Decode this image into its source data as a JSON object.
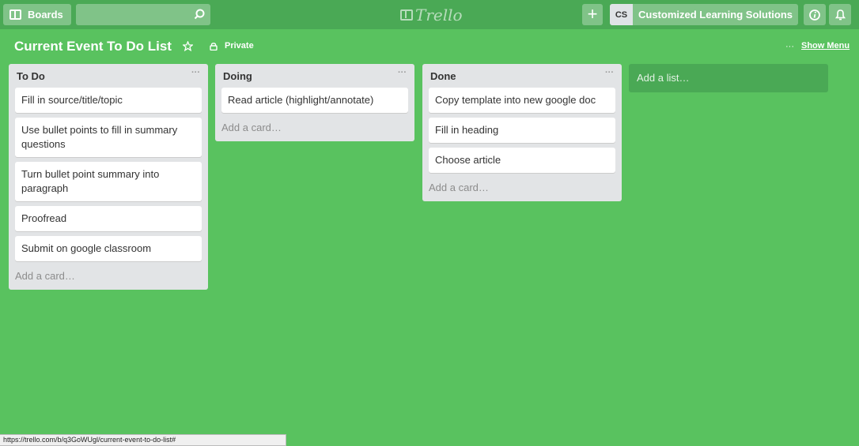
{
  "header": {
    "boards_label": "Boards",
    "search_placeholder": "",
    "logo_text": "Trello",
    "add_label": "+",
    "avatar_initials": "CS",
    "account_name": "Customized Learning Solutions"
  },
  "board": {
    "title": "Current Event To Do List",
    "visibility": "Private",
    "menu_dots": "···",
    "show_menu": "Show Menu"
  },
  "lists": [
    {
      "title": "To Do",
      "menu": "···",
      "cards": [
        "Fill in source/title/topic",
        "Use bullet points to fill in summary questions",
        "Turn bullet point summary into paragraph",
        "Proofread",
        "Submit on google classroom"
      ],
      "add_card": "Add a card…"
    },
    {
      "title": "Doing",
      "menu": "···",
      "cards": [
        "Read article (highlight/annotate)"
      ],
      "add_card": "Add a card…"
    },
    {
      "title": "Done",
      "menu": "···",
      "cards": [
        "Copy template into new google doc",
        "Fill in heading",
        "Choose article"
      ],
      "add_card": "Add a card…"
    }
  ],
  "add_list": "Add a list…",
  "status_url": "https://trello.com/b/q3GoWUgl/current-event-to-do-list#",
  "colors": {
    "board_bg": "#59c25f",
    "header_bg": "#4aa955",
    "list_bg": "#e2e4e6"
  }
}
